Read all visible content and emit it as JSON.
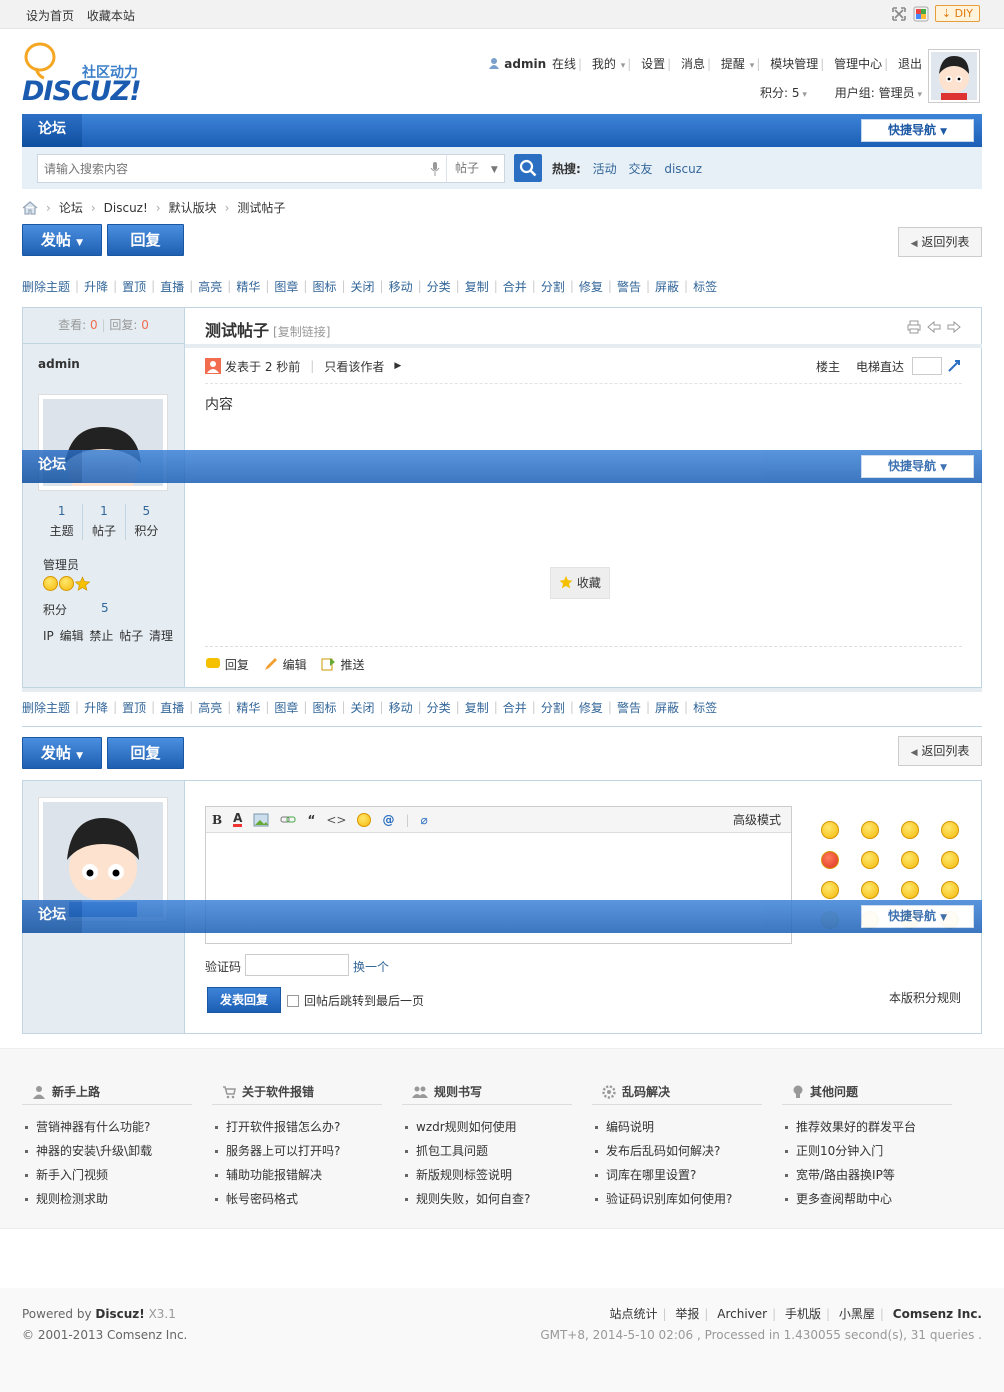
{
  "topbar": {
    "set_home": "设为首页",
    "bookmark": "收藏本站",
    "diy": "DIY"
  },
  "logo": {
    "sub": "社区动力",
    "main": "DISCUZ!"
  },
  "user": {
    "name": "admin",
    "online": "在线",
    "my": "我的",
    "settings": "设置",
    "messages": "消息",
    "remind": "提醒",
    "module": "模块管理",
    "admin_center": "管理中心",
    "logout": "退出",
    "credits": "积分: 5",
    "group": "用户组: 管理员"
  },
  "nav": {
    "forum_tab": "论坛",
    "quick_nav": "快捷导航"
  },
  "search": {
    "placeholder": "请输入搜索内容",
    "scope": "帖子",
    "hot_label": "热搜:",
    "hot": [
      "活动",
      "交友",
      "discuz"
    ]
  },
  "breadcrumb": [
    "论坛",
    "Discuz!",
    "默认版块",
    "测试帖子"
  ],
  "buttons": {
    "new_post": "发帖",
    "reply": "回复",
    "back_list": "返回列表"
  },
  "moderation": [
    "删除主题",
    "升降",
    "置顶",
    "直播",
    "高亮",
    "精华",
    "图章",
    "图标",
    "关闭",
    "移动",
    "分类",
    "复制",
    "合并",
    "分割",
    "修复",
    "警告",
    "屏蔽",
    "标签"
  ],
  "post": {
    "views_label": "查看:",
    "views": "0",
    "replies_label": "回复:",
    "replies": "0",
    "title": "测试帖子",
    "copy_link": "[复制链接]",
    "author": "admin",
    "posted": "发表于 2 秒前",
    "only_author": "只看该作者",
    "floor": "楼主",
    "jump": "电梯直达",
    "content": "内容",
    "favorite": "收藏",
    "actions": {
      "reply": "回复",
      "edit": "编辑",
      "push": "推送"
    },
    "stats": [
      {
        "value": "1",
        "label": "主题"
      },
      {
        "value": "1",
        "label": "帖子"
      },
      {
        "value": "5",
        "label": "积分"
      }
    ],
    "group": "管理员",
    "credits_label": "积分",
    "credits": "5",
    "admin_links": "IP 编辑 禁止 帖子 清理"
  },
  "editor": {
    "advanced": "高级模式",
    "captcha_label": "验证码",
    "captcha_change": "换一个",
    "submit": "发表回复",
    "jump_last": "回帖后跳转到最后一页",
    "rules": "本版积分规则"
  },
  "help": [
    {
      "title": "新手上路",
      "items": [
        "营销神器有什么功能?",
        "神器的安装\\升级\\卸载",
        "新手入门视频",
        "规则检测求助"
      ]
    },
    {
      "title": "关于软件报错",
      "items": [
        "打开软件报错怎么办?",
        "服务器上可以打开吗?",
        "辅助功能报错解决",
        "帐号密码格式"
      ]
    },
    {
      "title": "规则书写",
      "items": [
        "wzdr规则如何使用",
        "抓包工具问题",
        "新版规则标签说明",
        "规则失败，如何自查?"
      ]
    },
    {
      "title": "乱码解决",
      "items": [
        "编码说明",
        "发布后乱码如何解决?",
        "词库在哪里设置?",
        "验证码识别库如何使用?"
      ]
    },
    {
      "title": "其他问题",
      "items": [
        "推荐效果好的群发平台",
        "正则10分钟入门",
        "宽带/路由器换IP等",
        "更多查阅帮助中心"
      ]
    }
  ],
  "footer": {
    "powered": "Powered by",
    "product": "Discuz!",
    "version": "X3.1",
    "copyright": "© 2001-2013 Comsenz Inc.",
    "links": [
      "站点统计",
      "举报",
      "Archiver",
      "手机版",
      "小黑屋"
    ],
    "company": "Comsenz Inc.",
    "runtime": "GMT+8, 2014-5-10 02:06 , Processed in 1.430055 second(s), 31 queries ."
  },
  "colors": {
    "nav_blue": "#1b5fb5",
    "link": "#336699",
    "panel": "#e5edf2"
  }
}
